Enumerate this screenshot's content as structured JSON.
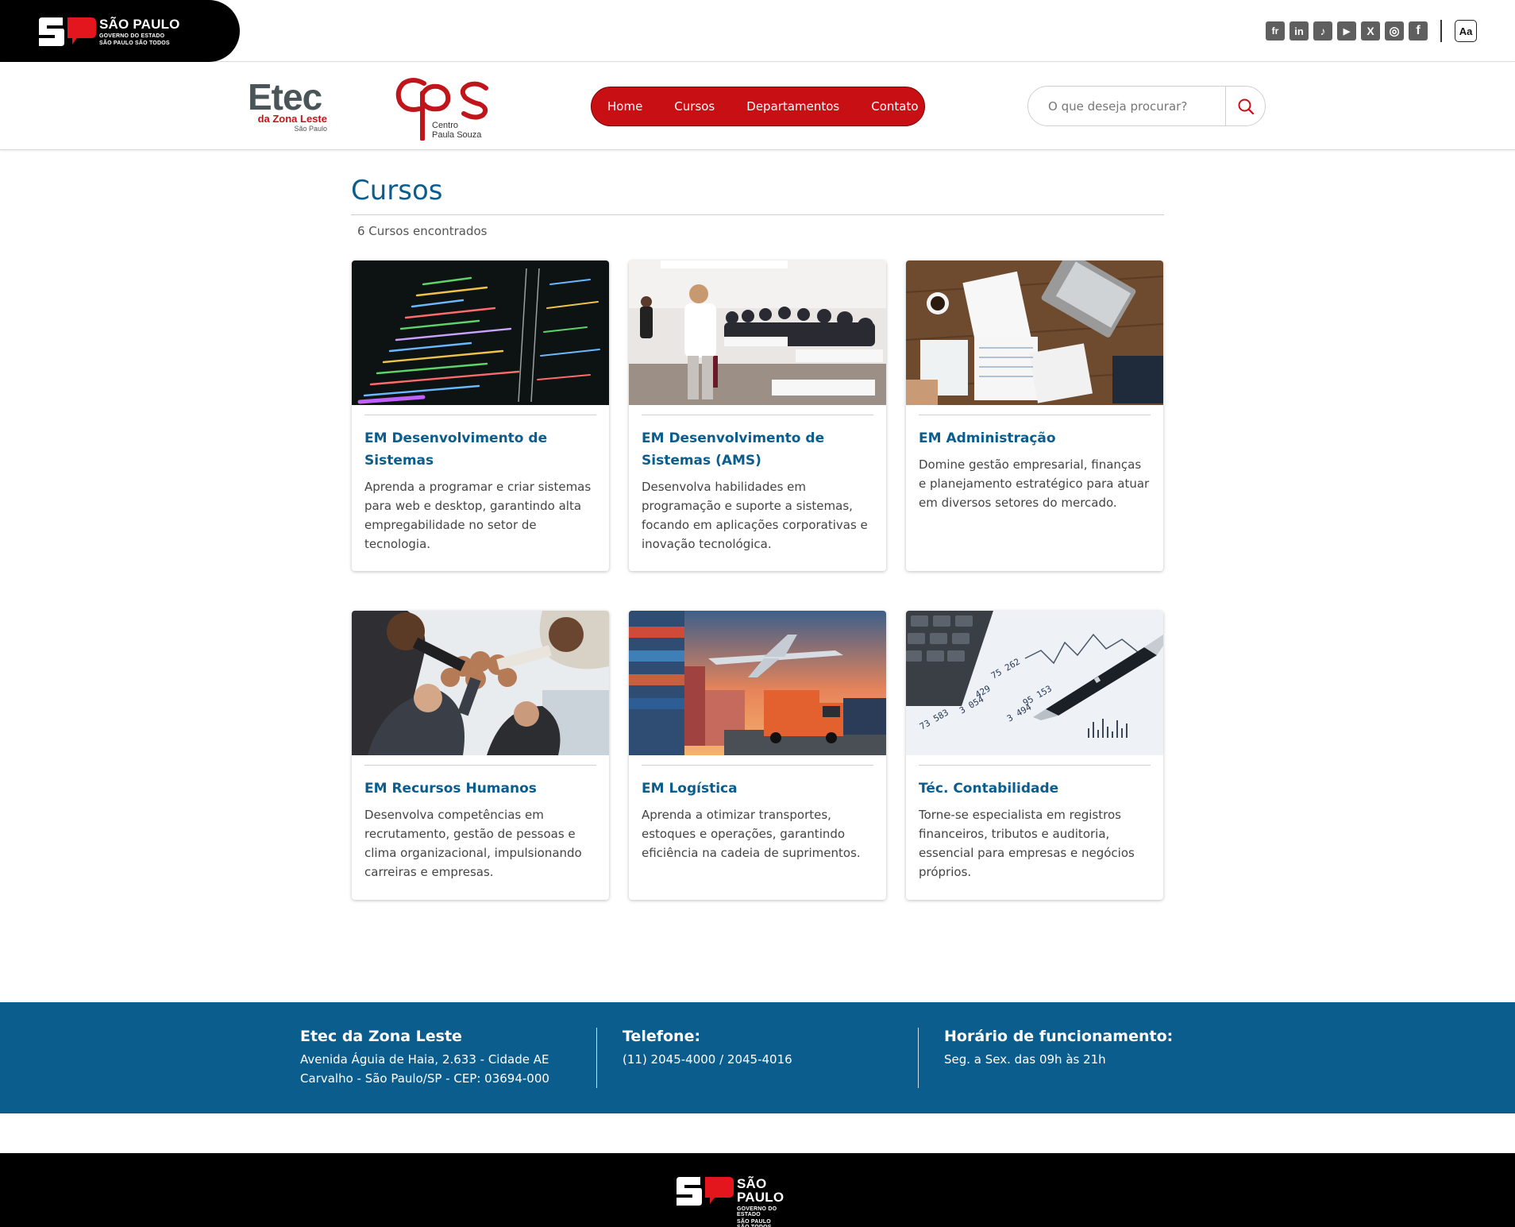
{
  "gov": {
    "title": "SÃO PAULO",
    "line2": "GOVERNO DO ESTADO",
    "line3": "SÃO PAULO SÃO TODOS"
  },
  "social": [
    {
      "name": "flickr-icon",
      "glyph": "fr"
    },
    {
      "name": "linkedin-icon",
      "glyph": "in"
    },
    {
      "name": "tiktok-icon",
      "glyph": "♪"
    },
    {
      "name": "youtube-icon",
      "glyph": "▶"
    },
    {
      "name": "x-icon",
      "glyph": "X"
    },
    {
      "name": "instagram-icon",
      "glyph": "◎"
    },
    {
      "name": "facebook-icon",
      "glyph": "f"
    }
  ],
  "accessibility": {
    "font_button": "Aa"
  },
  "header": {
    "etec": {
      "name": "Etec",
      "sub": "da Zona Leste",
      "city": "São Paulo"
    },
    "cps": {
      "line1": "Centro",
      "line2": "Paula Souza"
    }
  },
  "nav": {
    "home": "Home",
    "cursos": "Cursos",
    "departamentos": "Departamentos",
    "contato": "Contato"
  },
  "search": {
    "placeholder": "O que deseja procurar?"
  },
  "main": {
    "title": "Cursos",
    "count": "6 Cursos encontrados"
  },
  "courses": [
    {
      "title": "EM Desenvolvimento de Sistemas",
      "desc": "Aprenda a programar e criar sistemas para web e desktop, garantindo alta empregabilidade no setor de tecnologia.",
      "image": "code-screen"
    },
    {
      "title": "EM Desenvolvimento de Sistemas (AMS)",
      "desc": "Desenvolva habilidades em programação e suporte a sistemas, focando em aplicações corporativas e inovação tecnológica.",
      "image": "classroom"
    },
    {
      "title": "EM Administração",
      "desc": "Domine gestão empresarial, finanças e planejamento estratégico para atuar em diversos setores do mercado.",
      "image": "business-desk"
    },
    {
      "title": "EM Recursos Humanos",
      "desc": "Desenvolva competências em recrutamento, gestão de pessoas e clima organizacional, impulsionando carreiras e empresas.",
      "image": "team-fist-bump"
    },
    {
      "title": "EM Logística",
      "desc": "Aprenda a otimizar transportes, estoques e operações, garantindo eficiência na cadeia de suprimentos.",
      "image": "logistics"
    },
    {
      "title": "Téc. Contabilidade",
      "desc": "Torne-se especialista em registros financeiros, tributos e auditoria, essencial para empresas e negócios próprios.",
      "image": "accounting"
    }
  ],
  "footer": {
    "school": {
      "title": "Etec da Zona Leste",
      "line1": "Avenida Águia de Haia, 2.633 - Cidade AE",
      "line2": "Carvalho - São Paulo/SP - CEP: 03694-000"
    },
    "phone": {
      "title": "Telefone:",
      "line1": "(11) 2045-4000 / 2045-4016"
    },
    "hours": {
      "title": "Horário de funcionamento:",
      "line1": "Seg. a Sex. das 09h às 21h"
    }
  },
  "colors": {
    "brand_red": "#c80f14",
    "brand_blue": "#0b5d8e",
    "black": "#000000"
  }
}
